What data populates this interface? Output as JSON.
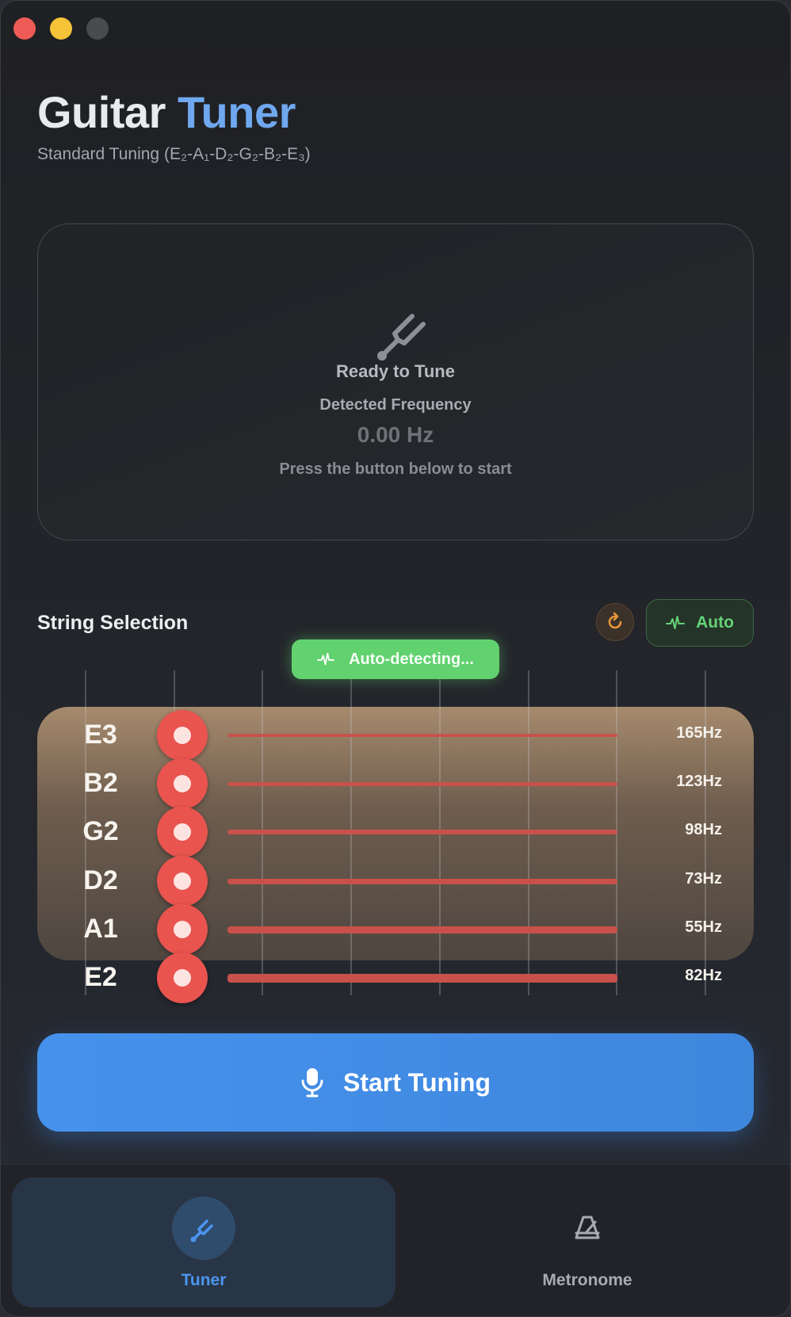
{
  "app": {
    "title_part1": "Guitar",
    "title_part2": "Tuner",
    "subtitle": "Standard Tuning (E₂-A₁-D₂-G₂-B₂-E₃)"
  },
  "status": {
    "icon": "tuning-fork-icon",
    "state_label": "Ready to Tune",
    "frequency_label": "Detected Frequency",
    "frequency_value": "0.00 Hz",
    "hint": "Press the button below to start"
  },
  "string_selection": {
    "title": "String Selection",
    "reset_icon": "refresh-icon",
    "auto_label": "Auto",
    "auto_detect_label": "Auto-detecting...",
    "strings": [
      {
        "note": "E3",
        "freq": "165Hz"
      },
      {
        "note": "B2",
        "freq": "123Hz"
      },
      {
        "note": "G2",
        "freq": "98Hz"
      },
      {
        "note": "D2",
        "freq": "73Hz"
      },
      {
        "note": "A1",
        "freq": "55Hz"
      },
      {
        "note": "E2",
        "freq": "82Hz"
      }
    ]
  },
  "actions": {
    "start_label": "Start Tuning",
    "start_icon": "microphone-icon"
  },
  "tabs": [
    {
      "label": "Tuner",
      "icon": "tuning-fork-icon",
      "active": true
    },
    {
      "label": "Metronome",
      "icon": "metronome-icon",
      "active": false
    }
  ],
  "colors": {
    "accent_blue": "#4592ec",
    "auto_green": "#62d16f",
    "peg_red": "#e9544f",
    "reset_orange": "#e8963a"
  }
}
